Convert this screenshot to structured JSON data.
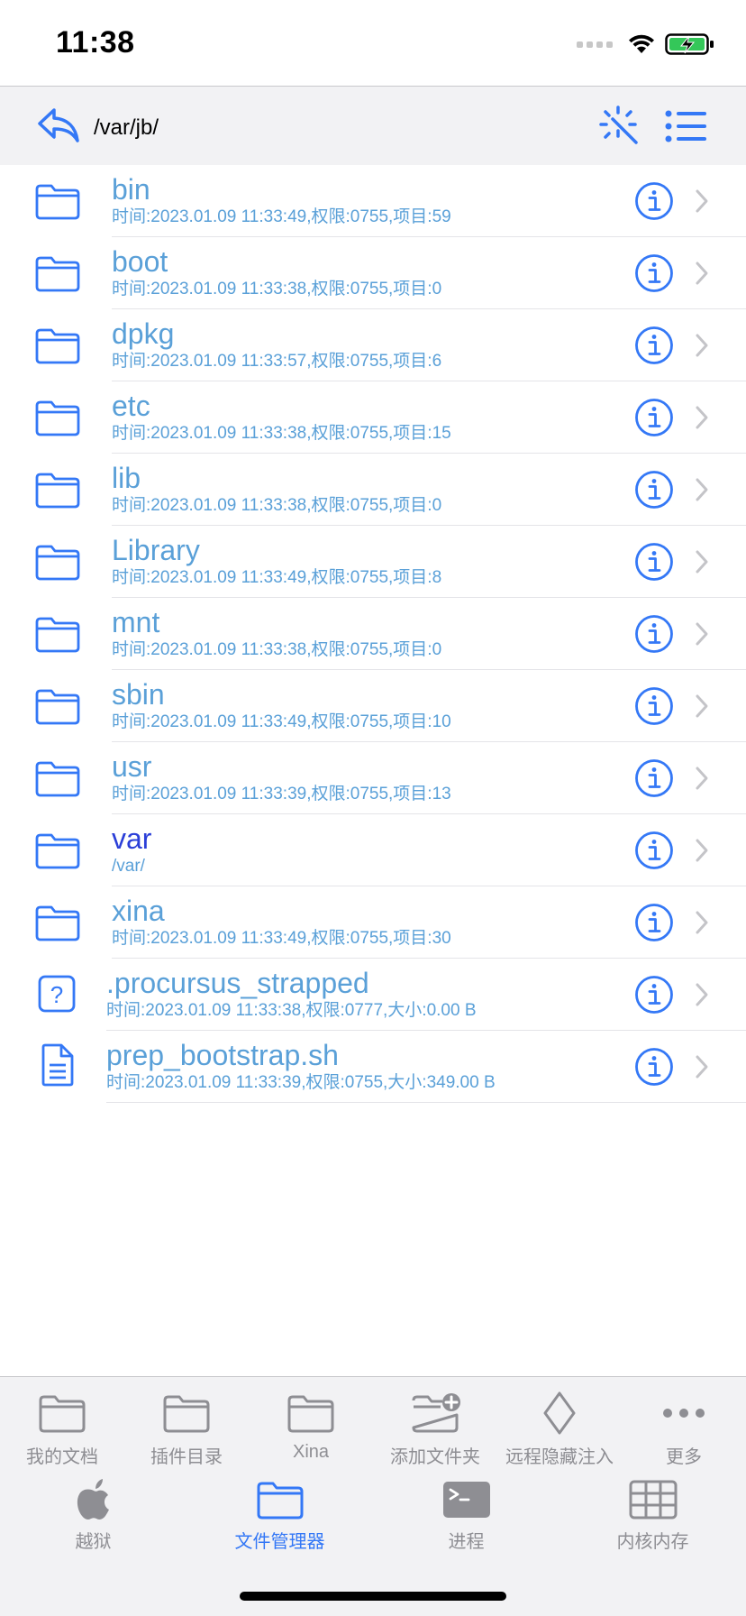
{
  "status_bar": {
    "time": "11:38"
  },
  "nav": {
    "path": "/var/jb/"
  },
  "files": [
    {
      "name": "bin",
      "meta": "时间:2023.01.09 11:33:49,权限:0755,项目:59",
      "kind": "folder",
      "link": false
    },
    {
      "name": "boot",
      "meta": "时间:2023.01.09 11:33:38,权限:0755,项目:0",
      "kind": "folder",
      "link": false
    },
    {
      "name": "dpkg",
      "meta": "时间:2023.01.09 11:33:57,权限:0755,项目:6",
      "kind": "folder",
      "link": false
    },
    {
      "name": "etc",
      "meta": "时间:2023.01.09 11:33:38,权限:0755,项目:15",
      "kind": "folder",
      "link": false
    },
    {
      "name": "lib",
      "meta": "时间:2023.01.09 11:33:38,权限:0755,项目:0",
      "kind": "folder",
      "link": false
    },
    {
      "name": "Library",
      "meta": "时间:2023.01.09 11:33:49,权限:0755,项目:8",
      "kind": "folder",
      "link": false
    },
    {
      "name": "mnt",
      "meta": "时间:2023.01.09 11:33:38,权限:0755,项目:0",
      "kind": "folder",
      "link": false
    },
    {
      "name": "sbin",
      "meta": "时间:2023.01.09 11:33:49,权限:0755,项目:10",
      "kind": "folder",
      "link": false
    },
    {
      "name": "usr",
      "meta": "时间:2023.01.09 11:33:39,权限:0755,项目:13",
      "kind": "folder",
      "link": false
    },
    {
      "name": "var",
      "meta": "/var/",
      "kind": "folder",
      "link": true
    },
    {
      "name": "xina",
      "meta": "时间:2023.01.09 11:33:49,权限:0755,项目:30",
      "kind": "folder",
      "link": false
    },
    {
      "name": ".procursus_strapped",
      "meta": "时间:2023.01.09 11:33:38,权限:0777,大小:0.00 B",
      "kind": "unknown",
      "link": false
    },
    {
      "name": "prep_bootstrap.sh",
      "meta": "时间:2023.01.09 11:33:39,权限:0755,大小:349.00 B",
      "kind": "document",
      "link": false
    }
  ],
  "toolbar": {
    "items": [
      {
        "label": "我的文档",
        "icon": "folder-icon"
      },
      {
        "label": "插件目录",
        "icon": "folder-icon"
      },
      {
        "label": "Xina",
        "icon": "folder-icon"
      },
      {
        "label": "添加文件夹",
        "icon": "folder-add-icon"
      },
      {
        "label": "远程隐藏注入",
        "icon": "diamond-icon"
      },
      {
        "label": "更多",
        "icon": "more-icon"
      }
    ]
  },
  "tabbar": {
    "items": [
      {
        "label": "越狱",
        "icon": "apple-icon",
        "active": false
      },
      {
        "label": "文件管理器",
        "icon": "folder-icon",
        "active": true
      },
      {
        "label": "进程",
        "icon": "terminal-icon",
        "active": false
      },
      {
        "label": "内核内存",
        "icon": "table-icon",
        "active": false
      }
    ]
  },
  "colors": {
    "accent": "#3478f6",
    "list_text": "#5aa0d8",
    "link_text": "#2b3fd8",
    "inactive_tab": "#8e8e93",
    "battery": "#34c759"
  }
}
